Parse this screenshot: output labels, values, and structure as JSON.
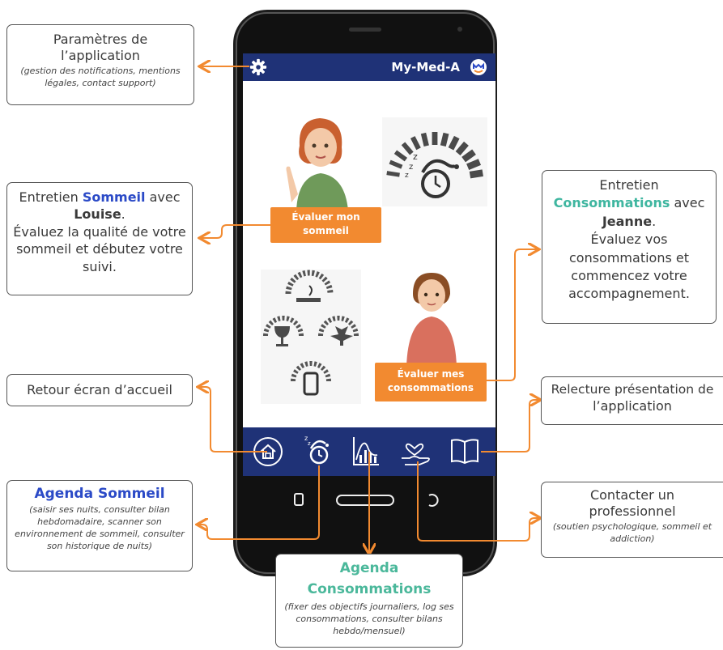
{
  "app": {
    "title": "My-Med-A"
  },
  "buttons": {
    "sleep": [
      "Évaluer mon",
      "sommeil"
    ],
    "consumption": [
      "Évaluer mes",
      "consommations"
    ]
  },
  "callouts": {
    "settings": {
      "title_1": "Paramètres de",
      "title_2": "l’application",
      "note": "(gestion des notifications, mentions légales, contact support)"
    },
    "sleep_interview": {
      "l1a": "Entretien ",
      "l1b": "Sommeil",
      "l1c": " avec",
      "l2a": "Louise",
      "l2b": ".",
      "l3": "Évaluez la qualité de votre",
      "l4": "sommeil et débutez votre",
      "l5": "suivi."
    },
    "consumption_interview": {
      "l1": "Entretien",
      "l2a": "Consommations",
      "l2b": " avec",
      "l3a": "Jeanne",
      "l3b": ".",
      "l4": "Évaluez vos",
      "l5": "consommations et",
      "l6": "commencez votre",
      "l7": "accompagnement."
    },
    "home": {
      "text": "Retour écran d’accueil"
    },
    "presentation": {
      "l1": "Relecture présentation de",
      "l2": "l’application"
    },
    "sleep_agenda": {
      "title": "Agenda Sommeil",
      "note": "(saisir ses nuits, consulter bilan hebdomadaire, scanner son environnement de sommeil, consulter son historique de nuits)"
    },
    "professional": {
      "l1": "Contacter un",
      "l2": "professionnel",
      "note": "(soutien psychologique, sommeil et addiction)"
    },
    "consumption_agenda": {
      "title_1": "Agenda",
      "title_2": "Consommations",
      "note": "(fixer des objectifs journaliers, log ses consommations, consulter bilans hebdo/mensuel)"
    }
  },
  "colors": {
    "app_bar": "#1f3277",
    "accent_orange": "#f28a30",
    "sleep_blue": "#2b4ac7",
    "consumption_teal": "#3fb6a0"
  },
  "icons": [
    "gear-icon",
    "app-logo-icon",
    "home-icon",
    "sleep-clock-icon",
    "chart-icon",
    "hand-heart-icon",
    "book-icon"
  ]
}
